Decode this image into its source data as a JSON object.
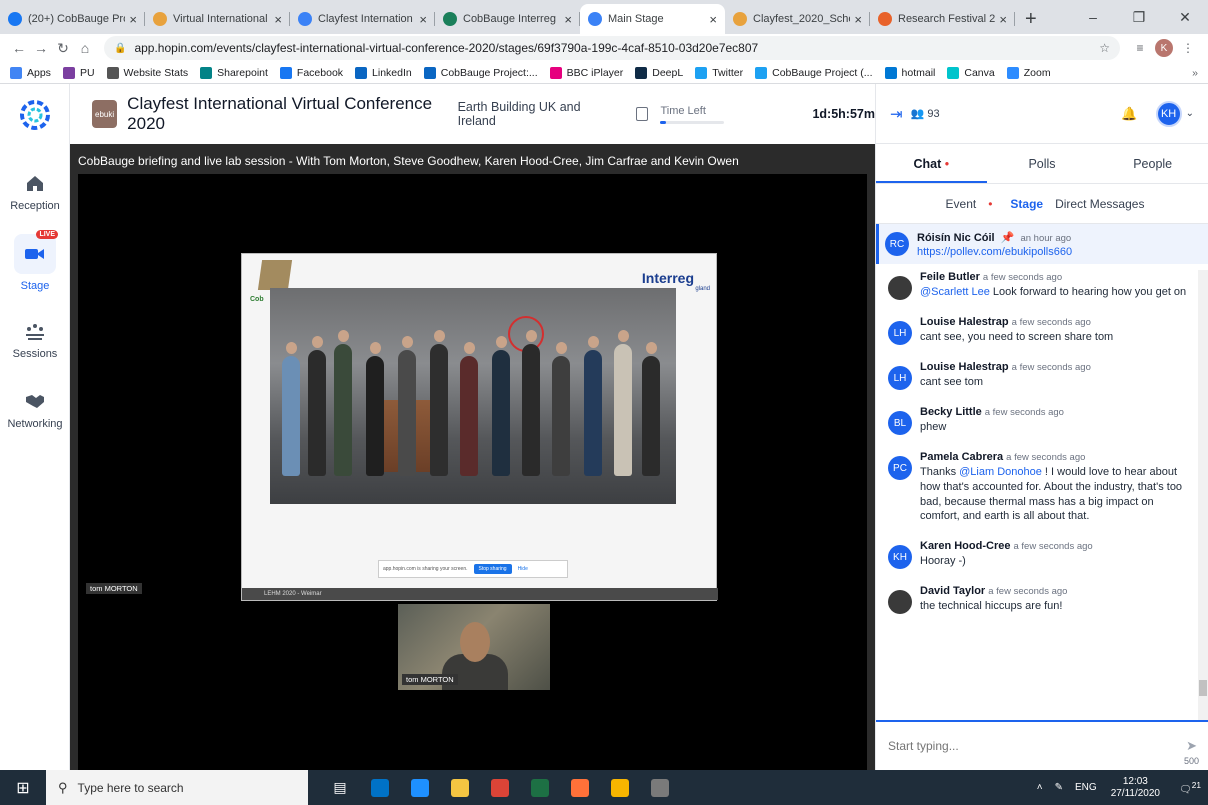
{
  "browser": {
    "tabs": [
      {
        "title": "(20+) CobBauge Pro",
        "color": "#1877f2",
        "active": false
      },
      {
        "title": "Virtual International",
        "color": "#e8a23d",
        "active": false
      },
      {
        "title": "Clayfest Internation",
        "color": "#3b82f6",
        "active": false
      },
      {
        "title": "CobBauge Interreg",
        "color": "#1a7f5a",
        "active": false
      },
      {
        "title": "Main Stage",
        "color": "#3b82f6",
        "active": true
      },
      {
        "title": "Clayfest_2020_Sche",
        "color": "#e8a23d",
        "active": false
      },
      {
        "title": "Research Festival 20",
        "color": "#e8622a",
        "active": false
      }
    ],
    "url": "app.hopin.com/events/clayfest-international-virtual-conference-2020/stages/69f3790a-199c-4caf-8510-03d20e7ec807",
    "profile_initial": "K",
    "bookmarks": [
      {
        "label": "Apps",
        "color": "#4285f4"
      },
      {
        "label": "PU",
        "color": "#7b3fa0"
      },
      {
        "label": "Website Stats",
        "color": "#555555"
      },
      {
        "label": "Sharepoint",
        "color": "#038387"
      },
      {
        "label": "Facebook",
        "color": "#1877f2"
      },
      {
        "label": "LinkedIn",
        "color": "#0a66c2"
      },
      {
        "label": "CobBauge Project:...",
        "color": "#0a66c2"
      },
      {
        "label": "BBC iPlayer",
        "color": "#e6007e"
      },
      {
        "label": "DeepL",
        "color": "#0f2b46"
      },
      {
        "label": "Twitter",
        "color": "#1da1f2"
      },
      {
        "label": "CobBauge Project (...",
        "color": "#1da1f2"
      },
      {
        "label": "hotmail",
        "color": "#0078d4"
      },
      {
        "label": "Canva",
        "color": "#00c4cc"
      },
      {
        "label": "Zoom",
        "color": "#2d8cff"
      }
    ],
    "bookmarks_more": "»"
  },
  "nav": {
    "items": [
      {
        "label": "Reception",
        "icon": "home-icon"
      },
      {
        "label": "Stage",
        "icon": "live-camera-icon",
        "badge": "LIVE"
      },
      {
        "label": "Sessions",
        "icon": "sessions-icon"
      },
      {
        "label": "Networking",
        "icon": "handshake-icon"
      }
    ]
  },
  "header": {
    "org_logo": "ebuki",
    "event_title": "Clayfest International Virtual Conference 2020",
    "organizer": "Earth Building UK and Ireland",
    "time_left_label": "Time Left",
    "time_left_progress": 0.08,
    "countdown": "1d:5h:57m"
  },
  "stage": {
    "session_title": "CobBauge briefing and live lab session - With Tom Morton, Steve Goodhew, Karen Hood-Cree, Jim Carfrae and Kevin Owen",
    "slide": {
      "brand": "Interreg",
      "brand_side": "gland",
      "logo_text": "Cob",
      "share_text": "app.hopin.com is sharing your screen.",
      "stop_label": "Stop sharing",
      "hide_label": "Hide",
      "footer": "LEHM 2020 - Weimar"
    },
    "presenter_tag": "tom MORTON",
    "camera_tag": "tom MORTON"
  },
  "panel": {
    "attendee_count": "93",
    "user_initials": "KH",
    "tabs": [
      "Chat",
      "Polls",
      "People"
    ],
    "subtabs": [
      "Event",
      "Stage",
      "Direct Messages"
    ],
    "pinned": {
      "initials": "RC",
      "name": "Róisín Nic Cóil",
      "time": "an hour ago",
      "text": "https://pollev.com/ebukipolls660"
    },
    "messages": [
      {
        "initials": "",
        "name": "Feile Butler",
        "time": "a few seconds ago",
        "mention": "@Scarlett Lee",
        "text": " Look forward to hearing how you get on",
        "photo": true
      },
      {
        "initials": "LH",
        "name": "Louise Halestrap",
        "time": "a few seconds ago",
        "mention": "",
        "text": "cant see, you need to screen share tom",
        "photo": false
      },
      {
        "initials": "LH",
        "name": "Louise Halestrap",
        "time": "a few seconds ago",
        "mention": "",
        "text": "cant see tom",
        "photo": false
      },
      {
        "initials": "BL",
        "name": "Becky Little",
        "time": "a few seconds ago",
        "mention": "",
        "text": "phew",
        "photo": false
      },
      {
        "initials": "PC",
        "name": "Pamela Cabrera",
        "time": "a few seconds ago",
        "pre": "Thanks ",
        "mention": "@Liam Donohoe",
        "text": " ! I would love to hear about how that's accounted for. About the industry, that's too bad, because thermal mass has a big impact on comfort, and earth is all about that.",
        "photo": false
      },
      {
        "initials": "KH",
        "name": "Karen Hood-Cree",
        "time": "a few seconds ago",
        "mention": "",
        "text": "Hooray -)",
        "photo": false
      },
      {
        "initials": "",
        "name": "David Taylor",
        "time": "a few seconds ago",
        "mention": "",
        "text": "the technical hiccups are fun!",
        "photo": true
      }
    ],
    "input_placeholder": "Start typing...",
    "char_limit": "500"
  },
  "taskbar": {
    "search_placeholder": "Type here to search",
    "lang": "ENG",
    "time": "12:03",
    "date": "27/11/2020",
    "notifications": "21",
    "apps": [
      "#0072c6",
      "#1e90ff",
      "#f4c542",
      "#db4437",
      "#1d7044",
      "#ff7139",
      "#f7b500",
      "#7a7a7a"
    ]
  }
}
